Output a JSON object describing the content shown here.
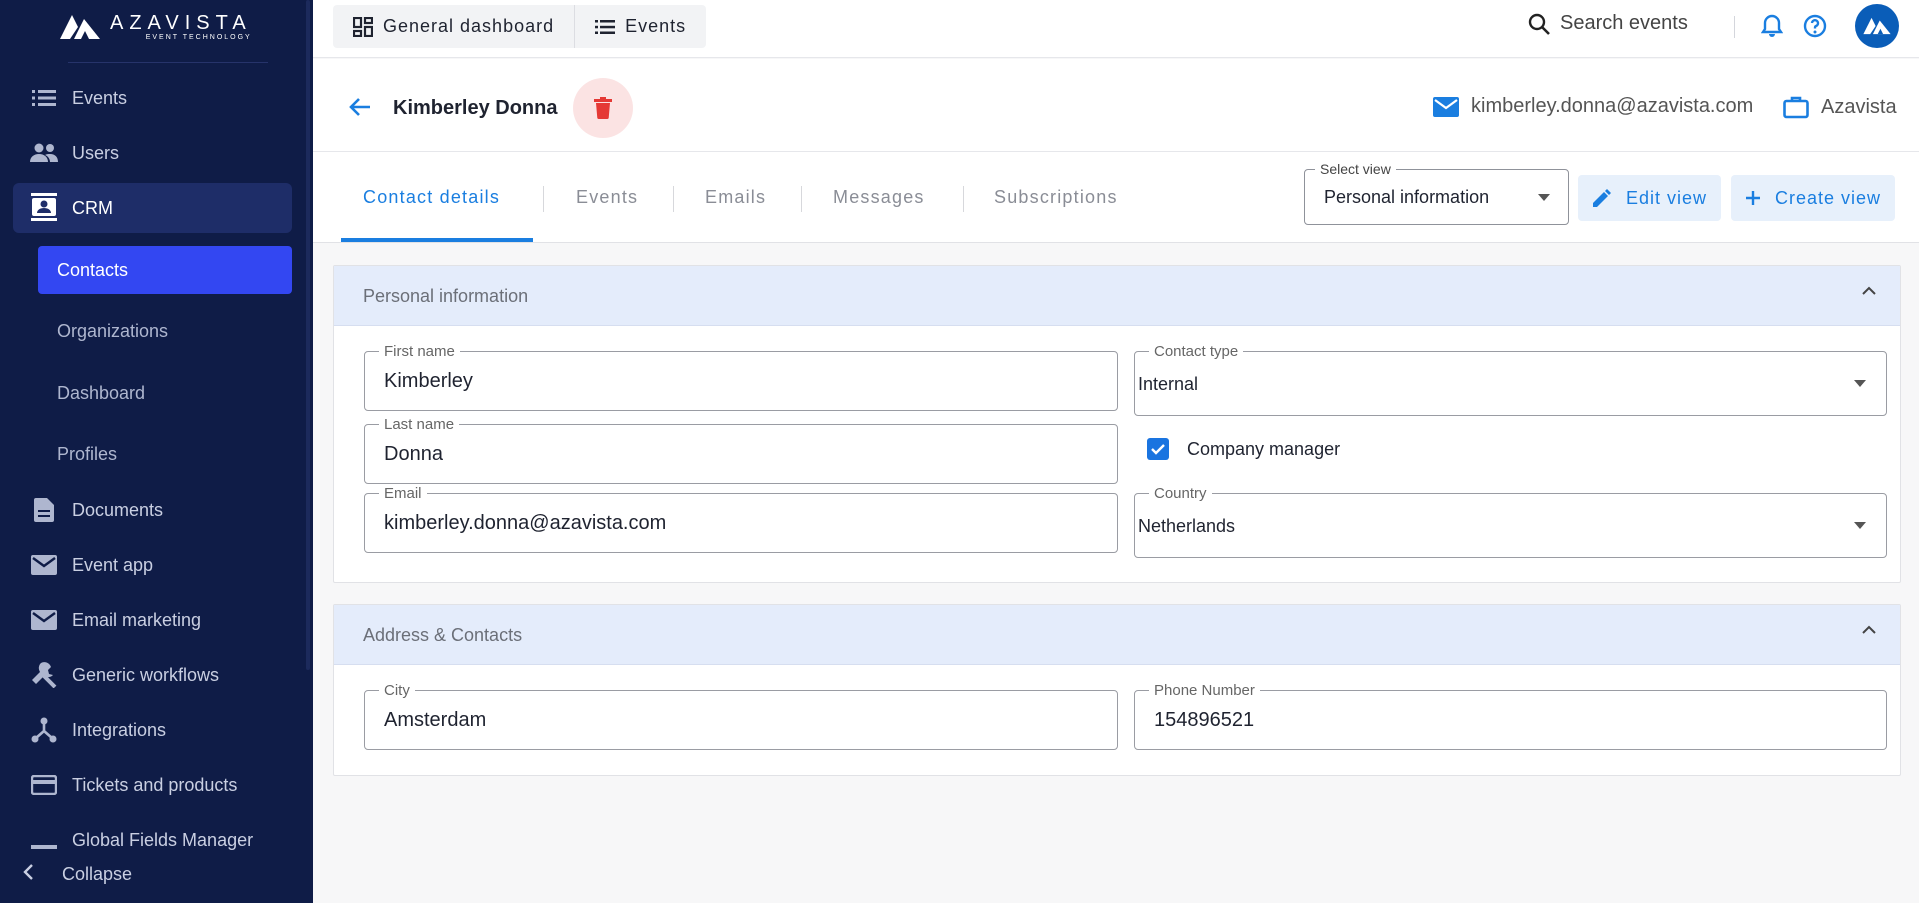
{
  "brand": {
    "name": "AZAVISTA",
    "tagline": "EVENT TECHNOLOGY"
  },
  "sidebar": {
    "items": [
      {
        "label": "Events",
        "icon": "list-icon"
      },
      {
        "label": "Users",
        "icon": "people-icon"
      },
      {
        "label": "CRM",
        "icon": "contact-card-icon"
      },
      {
        "label": "Documents",
        "icon": "document-icon"
      },
      {
        "label": "Event app",
        "icon": "mail-icon"
      },
      {
        "label": "Email marketing",
        "icon": "mail-icon"
      },
      {
        "label": "Generic workflows",
        "icon": "wrench-icon"
      },
      {
        "label": "Integrations",
        "icon": "integration-icon"
      },
      {
        "label": "Tickets and products",
        "icon": "card-icon"
      },
      {
        "label": "Global Fields Manager",
        "icon": "fields-icon"
      }
    ],
    "crm_sub": [
      "Contacts",
      "Organizations",
      "Dashboard",
      "Profiles"
    ],
    "collapse_label": "Collapse"
  },
  "topbar": {
    "tabs": [
      "General dashboard",
      "Events"
    ],
    "search_label": "Search events"
  },
  "contact": {
    "name": "Kimberley Donna",
    "email": "kimberley.donna@azavista.com",
    "organization": "Azavista"
  },
  "tabs": [
    "Contact details",
    "Events",
    "Emails",
    "Messages",
    "Subscriptions"
  ],
  "view": {
    "select_label": "Select view",
    "selected": "Personal information",
    "edit_label": "Edit view",
    "create_label": "Create view"
  },
  "sections": {
    "personal": {
      "title": "Personal information",
      "first_name_label": "First name",
      "first_name": "Kimberley",
      "last_name_label": "Last name",
      "last_name": "Donna",
      "email_label": "Email",
      "email": "kimberley.donna@azavista.com",
      "contact_type_label": "Contact type",
      "contact_type": "Internal",
      "company_manager_label": "Company manager",
      "country_label": "Country",
      "country": "Netherlands"
    },
    "address": {
      "title": "Address & Contacts",
      "city_label": "City",
      "city": "Amsterdam",
      "phone_label": "Phone Number",
      "phone": "154896521"
    }
  },
  "colors": {
    "sidebar_bg": "#0f1c47",
    "selected_item": "#3347f2",
    "accent": "#1a7ee0",
    "delete_bg": "#fbe3e3",
    "delete_icon": "#e53935",
    "panel_head": "#e4ecfb"
  }
}
